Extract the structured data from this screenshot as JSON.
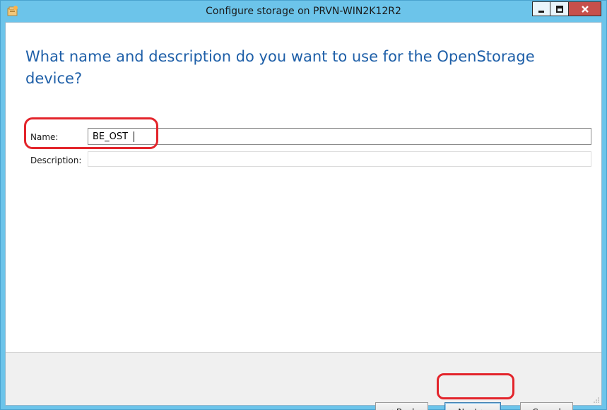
{
  "window": {
    "title": "Configure storage on PRVN-WIN2K12R2"
  },
  "page": {
    "heading": "What name and description do you want to use for the OpenStorage device?"
  },
  "form": {
    "name_label": "Name:",
    "name_value": "BE_OST",
    "description_label": "Description:",
    "description_value": ""
  },
  "buttons": {
    "back": "< Back",
    "next": "Next >",
    "cancel": "Cancel"
  },
  "colors": {
    "titlebar": "#6cc4ea",
    "heading": "#1e5fa8",
    "annotation": "#e3242b",
    "close_button": "#c7504b"
  }
}
